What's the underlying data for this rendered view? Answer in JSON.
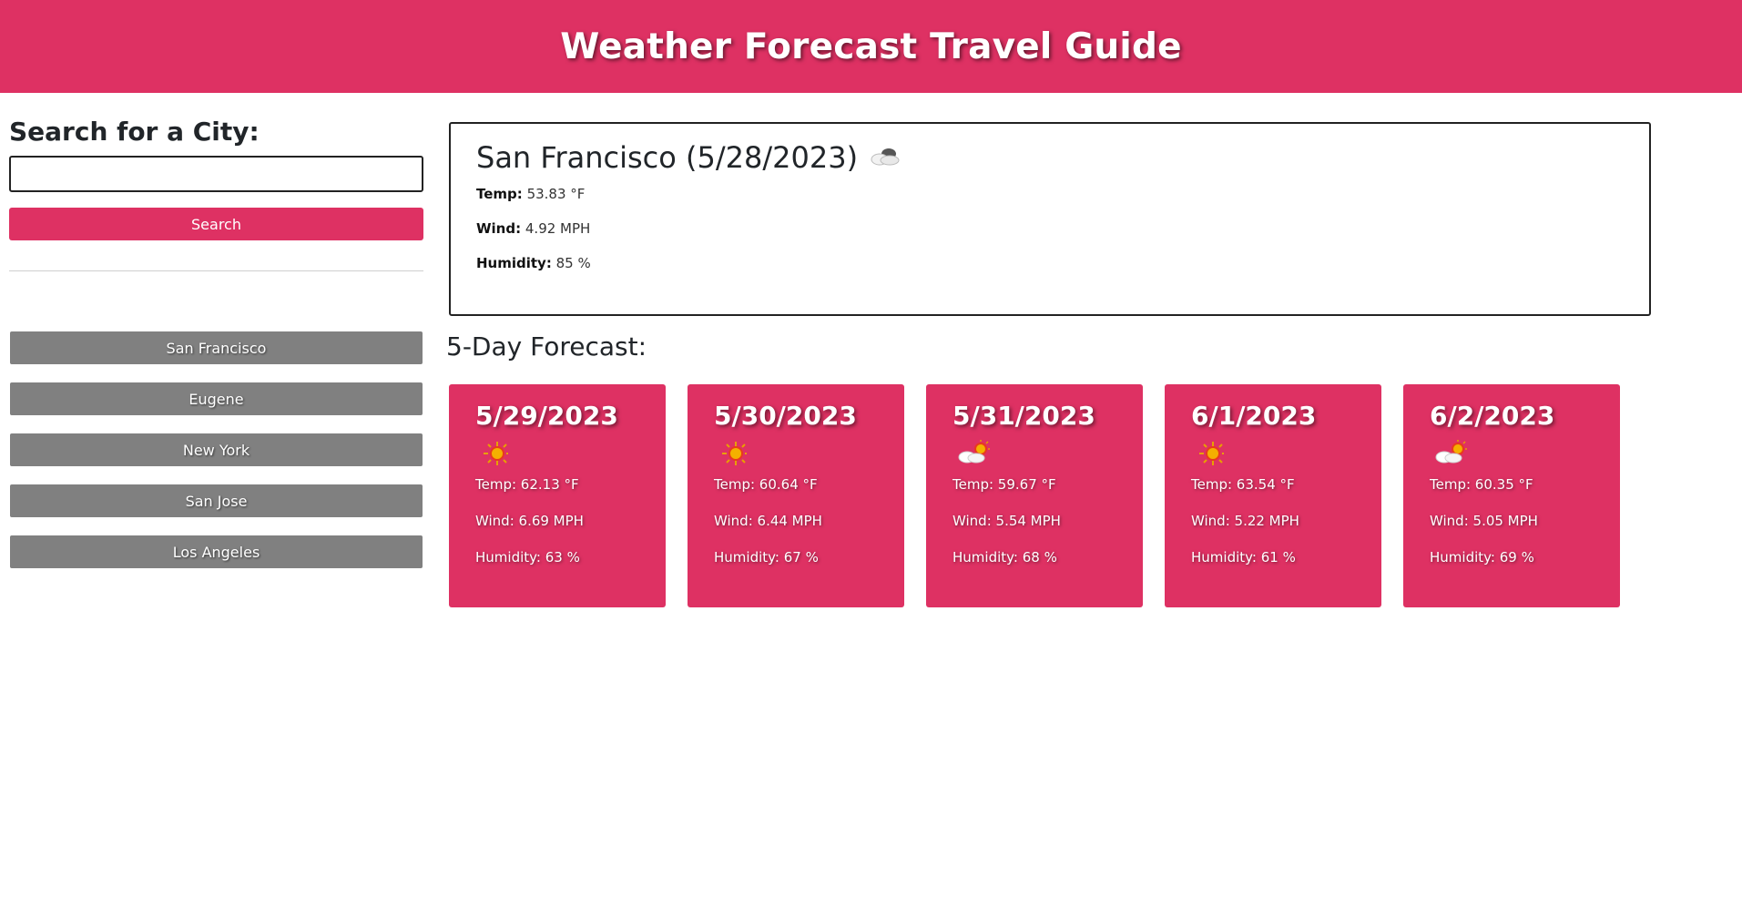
{
  "header": {
    "title": "Weather Forecast Travel Guide"
  },
  "sidebar": {
    "heading": "Search for a City:",
    "search_value": "",
    "search_button": "Search",
    "history": [
      "San Francisco",
      "Eugene",
      "New York",
      "San Jose",
      "Los Angeles"
    ]
  },
  "current": {
    "title": "San Francisco (5/28/2023)",
    "icon": "cloud-icon",
    "temp_label": "Temp:",
    "temp_value": "53.83 °F",
    "wind_label": "Wind:",
    "wind_value": "4.92 MPH",
    "humidity_label": "Humidity:",
    "humidity_value": "85 %"
  },
  "forecast": {
    "heading": "5-Day Forecast:",
    "days": [
      {
        "date": "5/29/2023",
        "icon": "sun-icon",
        "temp": "Temp: 62.13 °F",
        "wind": "Wind: 6.69 MPH",
        "humidity": "Humidity: 63 %"
      },
      {
        "date": "5/30/2023",
        "icon": "sun-icon",
        "temp": "Temp: 60.64 °F",
        "wind": "Wind: 6.44 MPH",
        "humidity": "Humidity: 67 %"
      },
      {
        "date": "5/31/2023",
        "icon": "partly-cloudy-icon",
        "temp": "Temp: 59.67 °F",
        "wind": "Wind: 5.54 MPH",
        "humidity": "Humidity: 68 %"
      },
      {
        "date": "6/1/2023",
        "icon": "sun-icon",
        "temp": "Temp: 63.54 °F",
        "wind": "Wind: 5.22 MPH",
        "humidity": "Humidity: 61 %"
      },
      {
        "date": "6/2/2023",
        "icon": "partly-cloudy-icon",
        "temp": "Temp: 60.35 °F",
        "wind": "Wind: 5.05 MPH",
        "humidity": "Humidity: 69 %"
      }
    ]
  },
  "colors": {
    "accent": "#de3163",
    "history_button": "#808080"
  }
}
